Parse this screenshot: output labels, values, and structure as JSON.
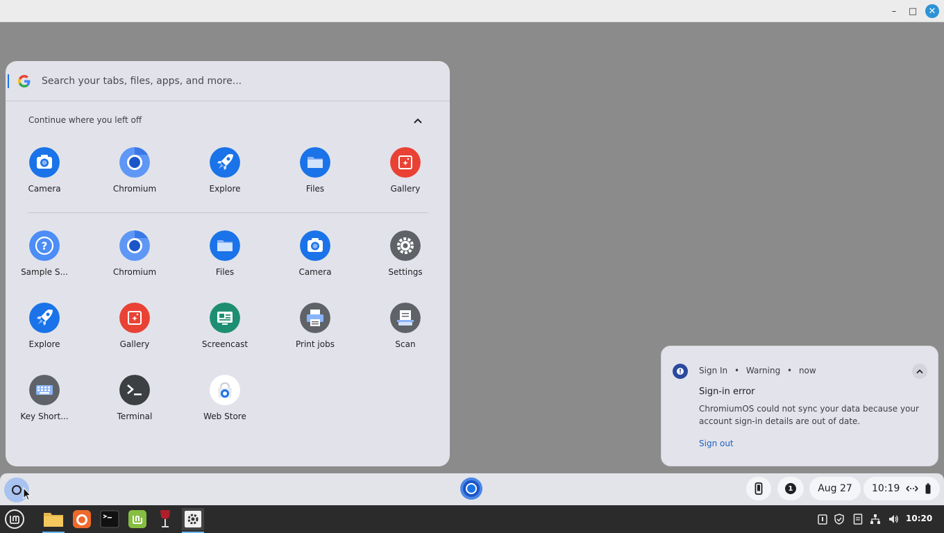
{
  "window": {
    "minimize_glyph": "–",
    "maximize_glyph": "□",
    "close_glyph": "✕"
  },
  "launcher": {
    "search": {
      "placeholder": "Search your tabs, files, apps, and more..."
    },
    "continue_section": {
      "title": "Continue where you left off",
      "items": [
        {
          "label": "Camera",
          "icon": "camera-icon"
        },
        {
          "label": "Chromium",
          "icon": "chromium-icon"
        },
        {
          "label": "Explore",
          "icon": "explore-icon"
        },
        {
          "label": "Files",
          "icon": "files-icon"
        },
        {
          "label": "Gallery",
          "icon": "gallery-icon"
        }
      ]
    },
    "apps": [
      {
        "label": "Sample S...",
        "icon": "help-icon"
      },
      {
        "label": "Chromium",
        "icon": "chromium-icon"
      },
      {
        "label": "Files",
        "icon": "files-icon"
      },
      {
        "label": "Camera",
        "icon": "camera-icon"
      },
      {
        "label": "Settings",
        "icon": "settings-icon"
      },
      {
        "label": "Explore",
        "icon": "explore-icon"
      },
      {
        "label": "Gallery",
        "icon": "gallery-icon"
      },
      {
        "label": "Screencast",
        "icon": "screencast-icon"
      },
      {
        "label": "Print jobs",
        "icon": "print-icon"
      },
      {
        "label": "Scan",
        "icon": "scan-icon"
      },
      {
        "label": "Key Short...",
        "icon": "keyboard-icon"
      },
      {
        "label": "Terminal",
        "icon": "terminal-icon"
      },
      {
        "label": "Web Store",
        "icon": "web-store-icon"
      }
    ]
  },
  "notification": {
    "source": "Sign In",
    "type": "Warning",
    "time": "now",
    "separator": "•",
    "title": "Sign-in error",
    "body": "ChromiumOS could not sync your data because your account sign-in details are out of date.",
    "action": "Sign out"
  },
  "shelf": {
    "notification_count": "1",
    "date": "Aug 27",
    "time": "10:19"
  },
  "taskbar": {
    "clock": "10:20"
  },
  "colors": {
    "accent": "#1a73e8",
    "launcher_bg": "#e2e3ea",
    "desktop_bg": "#8b8b8b",
    "warning_icon": "#2b4a9d",
    "link": "#1c5fbf"
  }
}
